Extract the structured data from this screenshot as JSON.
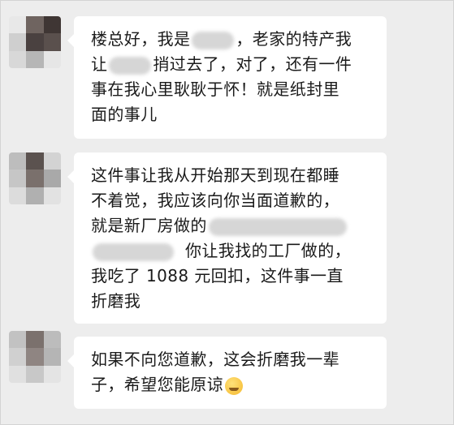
{
  "messages": [
    {
      "lines": [
        [
          "楼总好，我是",
          "[blur]",
          "，老家的特产我"
        ],
        [
          "让",
          "[blur]",
          "捎过去了，对了，还有一件"
        ],
        [
          "事在我心里耿耿于怀！就是纸封里"
        ],
        [
          "面的事儿"
        ]
      ]
    },
    {
      "lines": [
        [
          "这件事让我从开始那天到现在都睡"
        ],
        [
          "不着觉，我应该向你当面道歉的，"
        ],
        [
          "就是新厂房做的",
          "[blur]"
        ],
        [
          "[blur]",
          "你让我找的工厂做的，"
        ],
        [
          "我吃了 1088 元回扣，这件事一直"
        ],
        [
          "折磨我"
        ]
      ]
    },
    {
      "lines": [
        [
          "如果不向您道歉，这会折磨我一辈"
        ],
        [
          "子，希望您能原谅",
          "[emoji]"
        ]
      ]
    }
  ],
  "text": {
    "m1": [
      "楼总好，我是",
      "，老家的特产我",
      "让",
      "捎过去了，对了，还有一件",
      "事在我心里耿耿于怀！就是纸封里",
      "面的事儿"
    ],
    "m2": [
      "这件事让我从开始那天到现在都睡",
      "不着觉，我应该向你当面道歉的，",
      "就是新厂房做的",
      "你让我找的工厂做的，",
      "我吃了 1088 元回扣，这件事一直",
      "折磨我"
    ],
    "m3": [
      "如果不向您道歉，这会折磨我一辈",
      "子，希望您能原谅"
    ]
  },
  "icons": {
    "avatar": "blurred-avatar-icon",
    "emoji": "crying-laughing-emoji-icon"
  },
  "colors": {
    "background": "#ededed",
    "bubble": "#ffffff",
    "text": "#1a1a1a"
  }
}
